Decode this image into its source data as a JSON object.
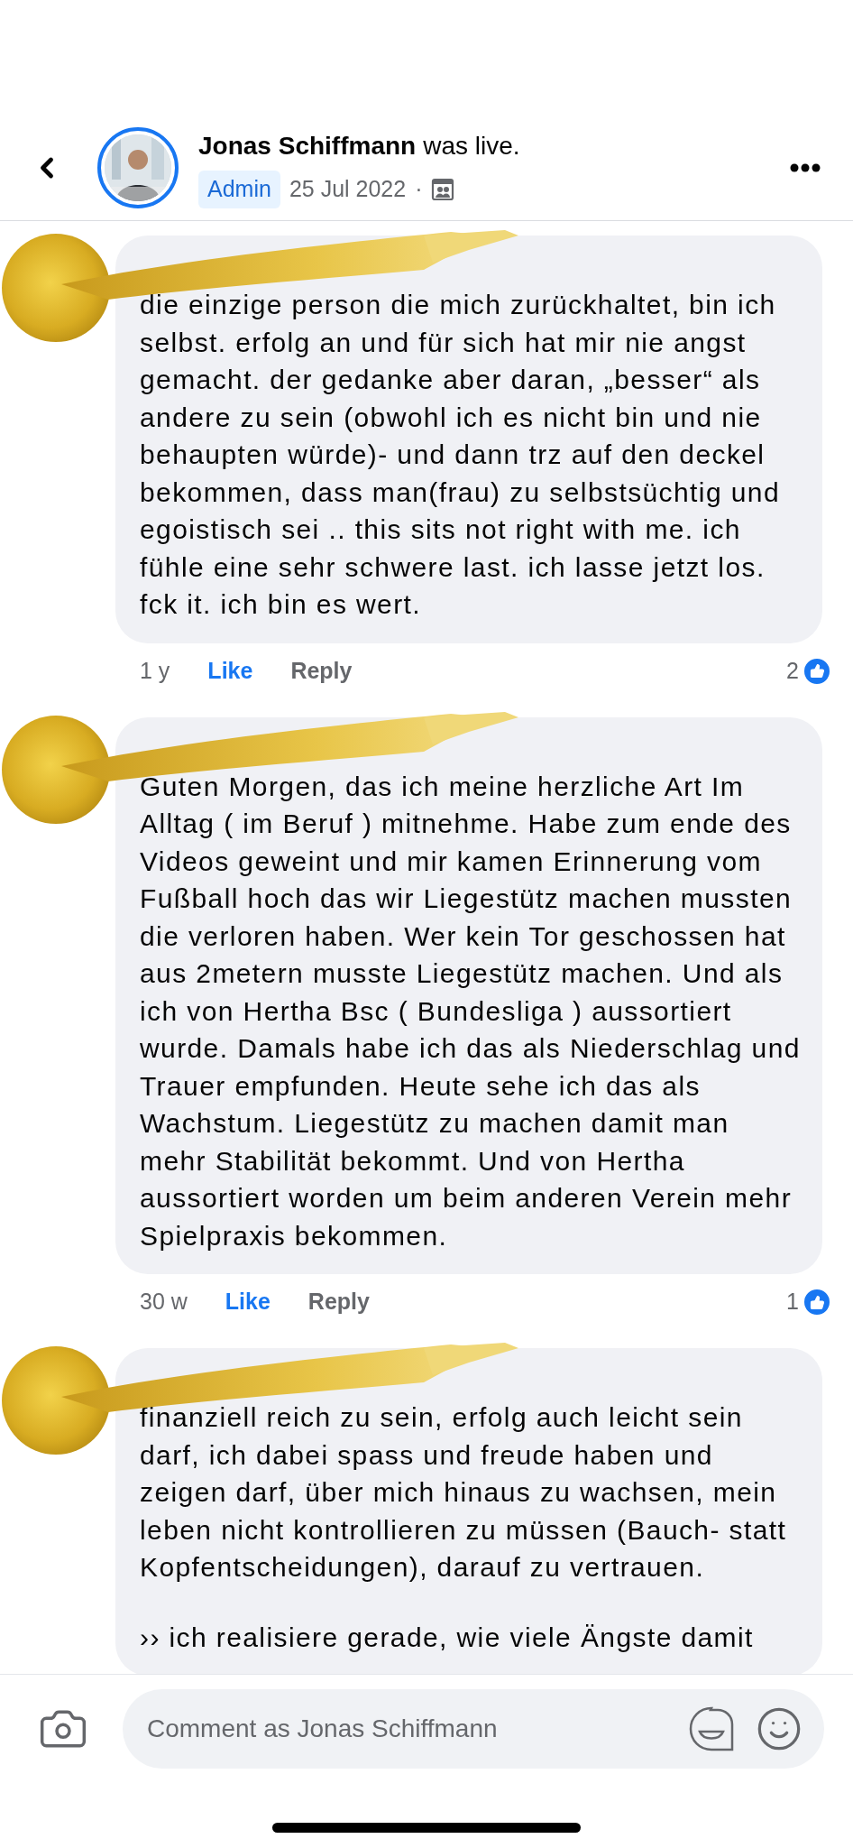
{
  "header": {
    "name": "Jonas Schiffmann",
    "action": "was live.",
    "badge": "Admin",
    "date": "25 Jul 2022",
    "separator": "·"
  },
  "comments": [
    {
      "paragraphs": [
        "die einzige person die mich zurückhaltet, bin ich selbst. erfolg an und für sich hat mir nie angst gemacht. der gedanke aber daran, „besser“ als andere zu sein (obwohl ich es nicht bin und nie behaupten würde)- und dann trz auf den deckel bekommen, dass man(frau) zu selbstsüchtig und egoistisch sei .. this sits not right with me. ich fühle eine sehr schwere last. ich lasse jetzt los. fck it. ich bin es wert."
      ],
      "time": "1 y",
      "like": "Like",
      "liked": true,
      "reply": "Reply",
      "reactions": "2"
    },
    {
      "paragraphs": [
        "Guten Morgen, das ich meine herzliche Art Im Alltag ( im Beruf ) mitnehme. Habe zum ende des Videos geweint und mir kamen Erinnerung vom Fußball hoch das wir Liegestütz machen mussten die verloren haben. Wer kein Tor geschossen hat aus 2metern musste Liegestütz machen. Und als ich von Hertha Bsc ( Bundesliga ) aussortiert wurde. Damals habe ich das als Niederschlag und Trauer empfunden. Heute sehe ich das als Wachstum. Liegestütz zu machen damit man mehr Stabilität bekommt. Und von Hertha aussortiert worden um beim anderen Verein mehr Spielpraxis bekommen."
      ],
      "time": "30 w",
      "like": "Like",
      "liked": true,
      "reply": "Reply",
      "reactions": "1"
    },
    {
      "paragraphs": [
        "finanziell reich zu sein, erfolg auch leicht sein darf, ich dabei spass und freude haben und zeigen darf, über mich hinaus zu wachsen, mein leben nicht kontrollieren zu müssen (Bauch- statt Kopfentscheidungen), darauf zu vertrauen.",
        "›› ich realisiere gerade, wie viele Ängste damit"
      ]
    }
  ],
  "composer": {
    "placeholder": "Comment as Jonas Schiffmann"
  }
}
